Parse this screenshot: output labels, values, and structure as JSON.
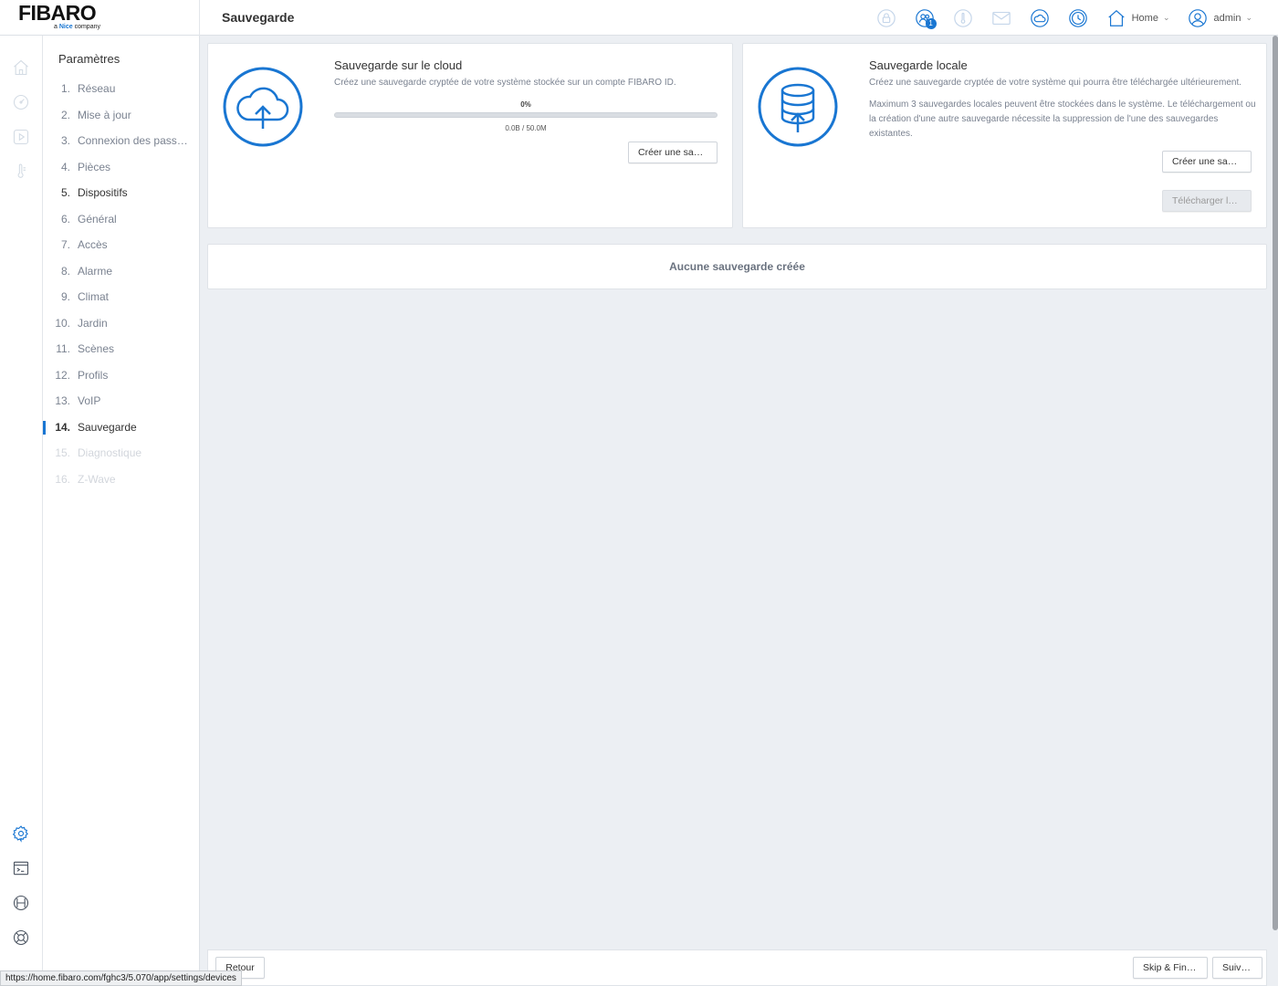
{
  "brand": {
    "name": "FIBARO",
    "tagline_prefix": "a ",
    "tagline_brand": "Nice",
    "tagline_suffix": " company"
  },
  "header": {
    "title": "Sauvegarde",
    "notification_count": "1",
    "home_label": "Home",
    "user_label": "admin",
    "accent_color": "#1976d2"
  },
  "settings": {
    "title": "Paramètres",
    "items": [
      {
        "num": "1.",
        "label": "Réseau"
      },
      {
        "num": "2.",
        "label": "Mise à jour"
      },
      {
        "num": "3.",
        "label": "Connexion des passerelles"
      },
      {
        "num": "4.",
        "label": "Pièces"
      },
      {
        "num": "5.",
        "label": "Dispositifs"
      },
      {
        "num": "6.",
        "label": "Général"
      },
      {
        "num": "7.",
        "label": "Accès"
      },
      {
        "num": "8.",
        "label": "Alarme"
      },
      {
        "num": "9.",
        "label": "Climat"
      },
      {
        "num": "10.",
        "label": "Jardin"
      },
      {
        "num": "11.",
        "label": "Scènes"
      },
      {
        "num": "12.",
        "label": "Profils"
      },
      {
        "num": "13.",
        "label": "VoIP"
      },
      {
        "num": "14.",
        "label": "Sauvegarde"
      },
      {
        "num": "15.",
        "label": "Diagnostique"
      },
      {
        "num": "16.",
        "label": "Z-Wave"
      }
    ]
  },
  "cloud_backup": {
    "title": "Sauvegarde sur le cloud",
    "description": "Créez une sauvegarde cryptée de votre système stockée sur un compte FIBARO ID.",
    "progress_label": "0%",
    "progress_value": 0,
    "size_label": "0.0B / 50.0M",
    "create_button": "Créer une sauvegarde"
  },
  "local_backup": {
    "title": "Sauvegarde locale",
    "description": "Créez une sauvegarde cryptée de votre système qui pourra être téléchargée ultérieurement.",
    "note": "Maximum 3 sauvegardes locales peuvent être stockées dans le système. Le téléchargement ou la création d'une autre sauvegarde nécessite la suppression de l'une des sauvegardes existantes.",
    "create_button": "Créer une sauvegarde",
    "download_button": "Télécharger la sauvegarde"
  },
  "backups_list": {
    "empty_text": "Aucune sauvegarde créée"
  },
  "footer": {
    "back_button": "Retour",
    "skip_button": "Skip & Finish",
    "next_button": "Suivant"
  },
  "status_url": "https://home.fibaro.com/fghc3/5.070/app/settings/devices"
}
